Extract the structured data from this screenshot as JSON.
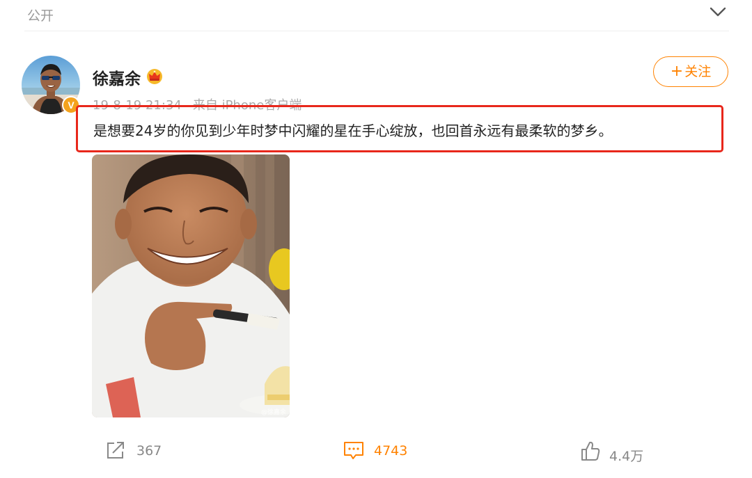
{
  "header": {
    "visibility_label": "公开",
    "collapse_icon": "chevron-down-icon"
  },
  "post": {
    "author": {
      "name": "徐嘉余",
      "badge_icon": "crown-icon",
      "verified_badge": "V",
      "verified_color": "#f4a21c"
    },
    "meta": {
      "date": "19-8-19 21:34",
      "source": "来自 iPhone客户端"
    },
    "follow_button": {
      "plus": "+",
      "label": "关注"
    },
    "text": "是想要24岁的你见到少年时梦中闪耀的星在手心绽放，也回首永远有最柔软的梦乡。",
    "highlight_color": "#e8271b",
    "image": {
      "description_icon": "photo-icon",
      "watermark": "@徐嘉余"
    }
  },
  "actions": {
    "repost": {
      "icon": "share-icon",
      "count": "367"
    },
    "comment": {
      "icon": "comment-icon",
      "count": "4743"
    },
    "like": {
      "icon": "thumbs-up-icon",
      "count": "4.4万"
    }
  },
  "colors": {
    "accent": "#ff8200",
    "muted_text": "#999999"
  }
}
